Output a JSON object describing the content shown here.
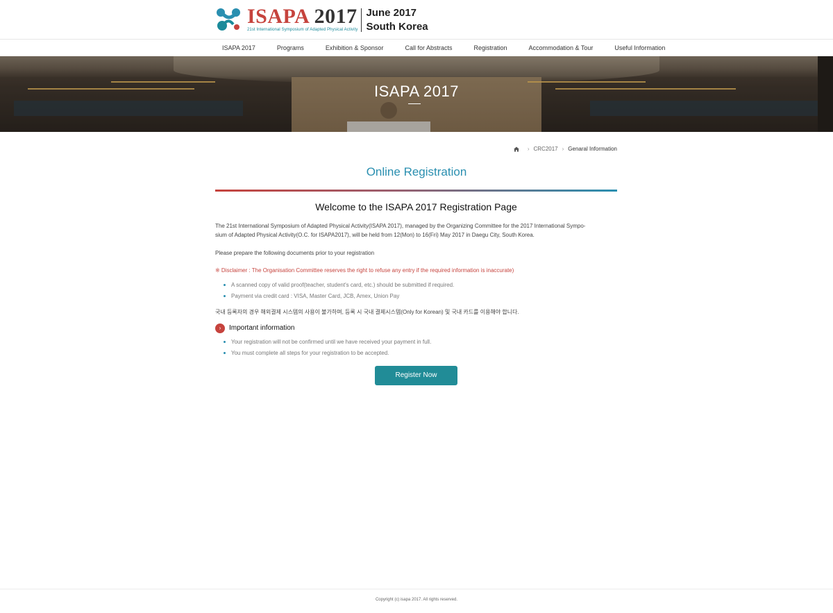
{
  "header": {
    "logo": {
      "name": "ISAPA",
      "year": "2017",
      "subtitle": "21st International Symposium of Adapted Physical Activity",
      "date_line1": "June 2017",
      "date_line2": "South Korea"
    }
  },
  "nav": {
    "items": [
      {
        "label": "ISAPA 2017"
      },
      {
        "label": "Programs"
      },
      {
        "label": "Exhibition & Sponsor"
      },
      {
        "label": "Call for Abstracts"
      },
      {
        "label": "Registration"
      },
      {
        "label": "Accommodation & Tour"
      },
      {
        "label": "Useful Information"
      }
    ]
  },
  "banner": {
    "title": "ISAPA 2017"
  },
  "breadcrumb": {
    "items": [
      "CRC2017",
      "Genaral Information"
    ]
  },
  "page": {
    "title": "Online Registration",
    "welcome": "Welcome to the ISAPA 2017 Registration Page",
    "paragraph1_line1": "The 21st International Symposium of Adapted Physical Activity(ISAPA 2017), managed by the Organizing Committee for the 2017 International Sympo-",
    "paragraph1_line2": "sium of Adapted Physical Activity(O.C. for ISAPA2017), will be held from 12(Mon) to 16(Fri) May 2017 in Daegu City, South Korea.",
    "paragraph2": "Please prepare the following documents prior to your registration",
    "disclaimer": "※ Disclaimer : The Organisation Committee reserves the right to refuse any entry if the required information is inaccurate)",
    "requirements": [
      "A scanned copy of valid proof(teacher, student's card, etc.) should be submitted if required.",
      "Payment via credit card : VISA, Master Card, JCB, Amex, Union Pay"
    ],
    "korean_note": "국내 등록자의 경우 해외결제 시스템의 사용이 불가하며, 등록 시 국내 결제시스템(Only for Korean) 및 국내 카드를 이용해야 합니다.",
    "important_title": "Important information",
    "important_icon": "›",
    "important_items": [
      "Your registration will not be confirmed until we have received your payment in full.",
      "You must complete all steps for your registration to be accepted."
    ],
    "register_label": "Register Now"
  },
  "footer": {
    "copyright": "Copyright (c) isapa 2017.  All rights reserved."
  },
  "colors": {
    "accent_red": "#c6433d",
    "accent_blue": "#2a8fb0",
    "button_teal": "#218c97"
  },
  "icons": {
    "home": "home-icon",
    "important": "chevron-right-icon"
  }
}
